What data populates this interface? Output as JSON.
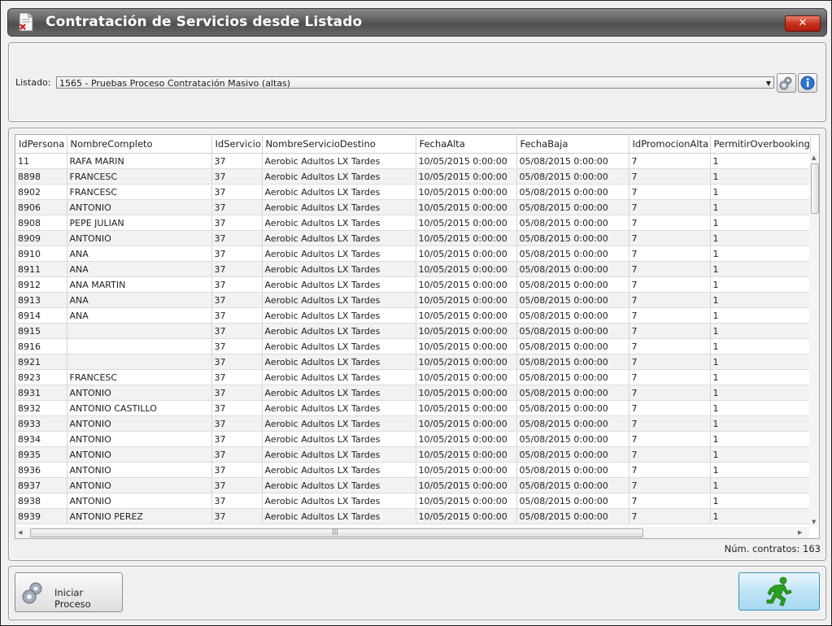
{
  "window": {
    "title": "Contratación de Servicios desde Listado",
    "close_label": "✕"
  },
  "selection": {
    "label": "Listado:",
    "value": "1565 - Pruebas Proceso Contratación Masivo (altas)"
  },
  "table": {
    "columns": [
      "IdPersona",
      "NombreCompleto",
      "IdServicio",
      "NombreServicioDestino",
      "FechaAlta",
      "FechaBaja",
      "IdPromocionAlta",
      "PermitirOverbooking"
    ],
    "rows": [
      [
        "11",
        "RAFA MARIN",
        "37",
        "Aerobic Adultos LX Tardes",
        "10/05/2015 0:00:00",
        "05/08/2015 0:00:00",
        "7",
        "1"
      ],
      [
        "8898",
        "FRANCESC",
        "37",
        "Aerobic Adultos LX Tardes",
        "10/05/2015 0:00:00",
        "05/08/2015 0:00:00",
        "7",
        "1"
      ],
      [
        "8902",
        "FRANCESC",
        "37",
        "Aerobic Adultos LX Tardes",
        "10/05/2015 0:00:00",
        "05/08/2015 0:00:00",
        "7",
        "1"
      ],
      [
        "8906",
        "ANTONIO",
        "37",
        "Aerobic Adultos LX Tardes",
        "10/05/2015 0:00:00",
        "05/08/2015 0:00:00",
        "7",
        "1"
      ],
      [
        "8908",
        "PEPE  JULIAN",
        "37",
        "Aerobic Adultos LX Tardes",
        "10/05/2015 0:00:00",
        "05/08/2015 0:00:00",
        "7",
        "1"
      ],
      [
        "8909",
        "ANTONIO",
        "37",
        "Aerobic Adultos LX Tardes",
        "10/05/2015 0:00:00",
        "05/08/2015 0:00:00",
        "7",
        "1"
      ],
      [
        "8910",
        "ANA",
        "37",
        "Aerobic Adultos LX Tardes",
        "10/05/2015 0:00:00",
        "05/08/2015 0:00:00",
        "7",
        "1"
      ],
      [
        "8911",
        "ANA",
        "37",
        "Aerobic Adultos LX Tardes",
        "10/05/2015 0:00:00",
        "05/08/2015 0:00:00",
        "7",
        "1"
      ],
      [
        "8912",
        "ANA  MARTIN",
        "37",
        "Aerobic Adultos LX Tardes",
        "10/05/2015 0:00:00",
        "05/08/2015 0:00:00",
        "7",
        "1"
      ],
      [
        "8913",
        "ANA",
        "37",
        "Aerobic Adultos LX Tardes",
        "10/05/2015 0:00:00",
        "05/08/2015 0:00:00",
        "7",
        "1"
      ],
      [
        "8914",
        "ANA",
        "37",
        "Aerobic Adultos LX Tardes",
        "10/05/2015 0:00:00",
        "05/08/2015 0:00:00",
        "7",
        "1"
      ],
      [
        "8915",
        "",
        "37",
        "Aerobic Adultos LX Tardes",
        "10/05/2015 0:00:00",
        "05/08/2015 0:00:00",
        "7",
        "1"
      ],
      [
        "8916",
        "",
        "37",
        "Aerobic Adultos LX Tardes",
        "10/05/2015 0:00:00",
        "05/08/2015 0:00:00",
        "7",
        "1"
      ],
      [
        "8921",
        "",
        "37",
        "Aerobic Adultos LX Tardes",
        "10/05/2015 0:00:00",
        "05/08/2015 0:00:00",
        "7",
        "1"
      ],
      [
        "8923",
        "FRANCESC",
        "37",
        "Aerobic Adultos LX Tardes",
        "10/05/2015 0:00:00",
        "05/08/2015 0:00:00",
        "7",
        "1"
      ],
      [
        "8931",
        "ANTONIO",
        "37",
        "Aerobic Adultos LX Tardes",
        "10/05/2015 0:00:00",
        "05/08/2015 0:00:00",
        "7",
        "1"
      ],
      [
        "8932",
        "ANTONIO CASTILLO",
        "37",
        "Aerobic Adultos LX Tardes",
        "10/05/2015 0:00:00",
        "05/08/2015 0:00:00",
        "7",
        "1"
      ],
      [
        "8933",
        "ANTONIO",
        "37",
        "Aerobic Adultos LX Tardes",
        "10/05/2015 0:00:00",
        "05/08/2015 0:00:00",
        "7",
        "1"
      ],
      [
        "8934",
        "ANTONIO",
        "37",
        "Aerobic Adultos LX Tardes",
        "10/05/2015 0:00:00",
        "05/08/2015 0:00:00",
        "7",
        "1"
      ],
      [
        "8935",
        "ANTONIO",
        "37",
        "Aerobic Adultos LX Tardes",
        "10/05/2015 0:00:00",
        "05/08/2015 0:00:00",
        "7",
        "1"
      ],
      [
        "8936",
        "ANTONIO",
        "37",
        "Aerobic Adultos LX Tardes",
        "10/05/2015 0:00:00",
        "05/08/2015 0:00:00",
        "7",
        "1"
      ],
      [
        "8937",
        "ANTONIO",
        "37",
        "Aerobic Adultos LX Tardes",
        "10/05/2015 0:00:00",
        "05/08/2015 0:00:00",
        "7",
        "1"
      ],
      [
        "8938",
        "ANTONIO",
        "37",
        "Aerobic Adultos LX Tardes",
        "10/05/2015 0:00:00",
        "05/08/2015 0:00:00",
        "7",
        "1"
      ],
      [
        "8939",
        "ANTONIO  PEREZ",
        "37",
        "Aerobic Adultos LX Tardes",
        "10/05/2015 0:00:00",
        "05/08/2015 0:00:00",
        "7",
        "1"
      ]
    ],
    "hscroll_grip": "|||"
  },
  "footer": {
    "count_text": "Núm. contratos: 163"
  },
  "actions": {
    "start_label": "Iniciar Proceso"
  },
  "colors": {
    "close_button": "#c8321c",
    "run_button": "#bfe4f6",
    "run_icon": "#28a81e"
  },
  "icons": {
    "app": "document-delete-icon",
    "settings": "gears-icon",
    "info": "info-icon",
    "start": "gears-icon",
    "run": "running-man-icon"
  }
}
